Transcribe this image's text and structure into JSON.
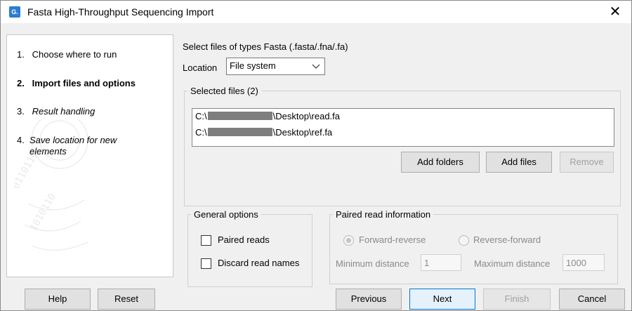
{
  "window": {
    "title": "Fasta High-Throughput Sequencing Import",
    "app_icon_text": "G.",
    "close_symbol": "✕"
  },
  "steps": [
    {
      "num": "1.",
      "label": "Choose where to run",
      "state": "done"
    },
    {
      "num": "2.",
      "label": "Import files and options",
      "state": "current"
    },
    {
      "num": "3.",
      "label": "Result handling",
      "state": "pending"
    },
    {
      "num": "4.",
      "label": "Save location for new elements",
      "state": "pending"
    }
  ],
  "files": {
    "types_label": "Select files of types Fasta (.fasta/.fna/.fa)",
    "location_label": "Location",
    "location_value": "File system",
    "group_legend": "Selected files (2)",
    "items": [
      {
        "prefix": "C:\\",
        "suffix": "\\Desktop\\read.fa"
      },
      {
        "prefix": "C:\\",
        "suffix": "\\Desktop\\ref.fa"
      }
    ],
    "add_folders_label": "Add folders",
    "add_files_label": "Add files",
    "remove_label": "Remove"
  },
  "general_options": {
    "legend": "General options",
    "paired_reads_label": "Paired reads",
    "paired_reads_checked": false,
    "discard_names_label": "Discard read names",
    "discard_names_checked": false
  },
  "paired_info": {
    "legend": "Paired read information",
    "forward_reverse_label": "Forward-reverse",
    "reverse_forward_label": "Reverse-forward",
    "selected": "Forward-reverse",
    "min_distance_label": "Minimum distance",
    "min_distance_value": "1",
    "max_distance_label": "Maximum distance",
    "max_distance_value": "1000"
  },
  "footer": {
    "help_label": "Help",
    "reset_label": "Reset",
    "previous_label": "Previous",
    "next_label": "Next",
    "finish_label": "Finish",
    "cancel_label": "Cancel"
  }
}
